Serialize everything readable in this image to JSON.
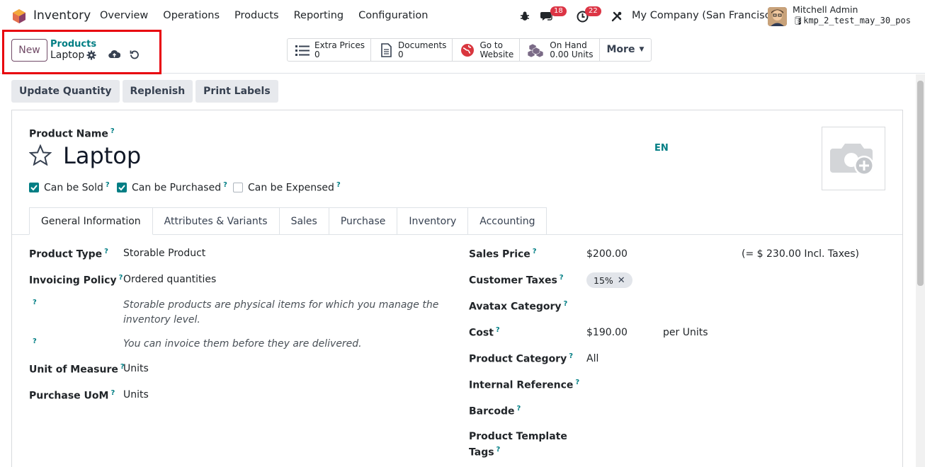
{
  "navbar": {
    "app_name": "Inventory",
    "menu": [
      "Overview",
      "Operations",
      "Products",
      "Reporting",
      "Configuration"
    ],
    "messages_count": "18",
    "activities_count": "22",
    "company": "My Company (San Francisco)",
    "user_name": "Mitchell Admin",
    "database": "kmp_2_test_may_30_pos"
  },
  "control_panel": {
    "new_label": "New",
    "breadcrumb_parent": "Products",
    "breadcrumb_current": "Laptop",
    "smart_buttons": [
      {
        "label": "Extra Prices",
        "value": "0",
        "icon": "list-icon"
      },
      {
        "label": "Documents",
        "value": "0",
        "icon": "document-icon"
      },
      {
        "label": "Go to",
        "value": "Website",
        "icon": "globe-icon"
      },
      {
        "label": "On Hand",
        "value": "0.00 Units",
        "icon": "cubes-icon"
      }
    ],
    "more_label": "More"
  },
  "actions": [
    "Update Quantity",
    "Replenish",
    "Print Labels"
  ],
  "form": {
    "product_name_label": "Product Name",
    "product_name": "Laptop",
    "lang": "EN",
    "can_be_sold": {
      "label": "Can be Sold",
      "checked": true
    },
    "can_be_purchased": {
      "label": "Can be Purchased",
      "checked": true
    },
    "can_be_expensed": {
      "label": "Can be Expensed",
      "checked": false
    },
    "tabs": [
      "General Information",
      "Attributes & Variants",
      "Sales",
      "Purchase",
      "Inventory",
      "Accounting"
    ],
    "left": {
      "product_type_label": "Product Type",
      "product_type": "Storable Product",
      "invoicing_policy_label": "Invoicing Policy",
      "invoicing_policy": "Ordered quantities",
      "note_storable": "Storable products are physical items for which you manage the inventory level.",
      "note_invoice": "You can invoice them before they are delivered.",
      "uom_label": "Unit of Measure",
      "uom": "Units",
      "purchase_uom_label": "Purchase UoM",
      "purchase_uom": "Units"
    },
    "right": {
      "sales_price_label": "Sales Price",
      "sales_price": "$200.00",
      "incl_taxes": "(= $ 230.00 Incl. Taxes)",
      "customer_taxes_label": "Customer Taxes",
      "tax_tag": "15%",
      "avatax_label": "Avatax Category",
      "cost_label": "Cost",
      "cost": "$190.00",
      "cost_unit": "per Units",
      "category_label": "Product Category",
      "category": "All",
      "internal_ref_label": "Internal Reference",
      "barcode_label": "Barcode",
      "template_tags_label_1": "Product Template",
      "template_tags_label_2": "Tags"
    }
  },
  "colors": {
    "brand": "#714b67",
    "teal": "#017e84",
    "badge": "#dc3545",
    "highlight": "#e8000b"
  }
}
